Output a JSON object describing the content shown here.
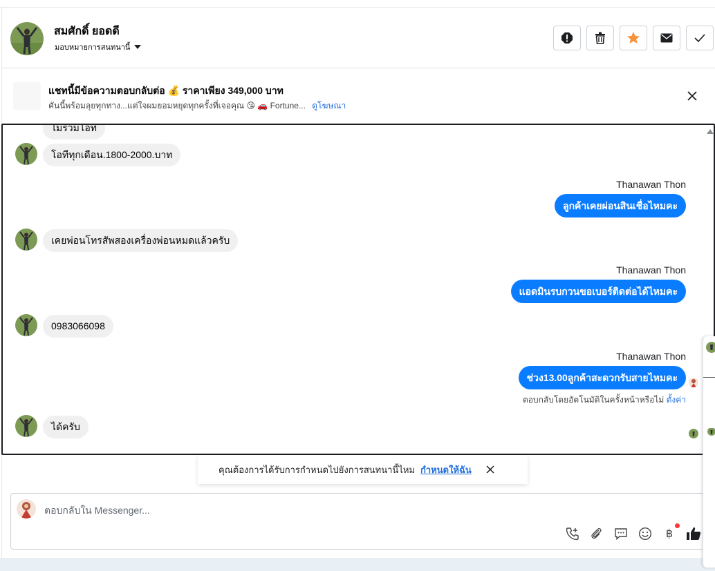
{
  "header": {
    "contact_name": "สมศักดิ์ ยอดดี",
    "assign_label": "มอบหมายการสนทนานี้",
    "actions": [
      {
        "name": "spam",
        "icon": "alert-icon"
      },
      {
        "name": "delete",
        "icon": "trash-icon"
      },
      {
        "name": "star",
        "icon": "star-icon",
        "color": "#f7923b"
      },
      {
        "name": "mark-unread",
        "icon": "envelope-icon"
      },
      {
        "name": "done",
        "icon": "check-icon"
      }
    ]
  },
  "ad": {
    "title": "แชทนี้มีข้อความตอบกลับต่อ 💰 ราคาเพียง 349,000 บาท",
    "subtitle": "คันนี้พร้อมลุยทุกทาง...แต่ใจผมยอมหยุดทุกครั้งที่เจอคุณ 😘 🚗 Fortune...",
    "link": "ดูโฆษณา"
  },
  "messages": {
    "partial_top": "ไม่รวมโอที",
    "m1": "โอทีทุกเดือน.1800-2000.บาท",
    "m2_sender": "Thanawan Thon",
    "m2": "ลูกค้าเคยผ่อนสินเชื่อไหมคะ",
    "m3": "เคยพ่อนโทรสัพสองเครื่องพ่อนหมดแล้วครับ",
    "m4_sender": "Thanawan Thon",
    "m4": "แอดมินรบกวนขอเบอร์ติดต่อได้ไหมคะ",
    "m5": "0983066098",
    "m6_sender": "Thanawan Thon",
    "m6": "ช่วง13.00ลูกค้าสะดวกรับสายไหมคะ",
    "auto_note": "ตอบกลับโดยอัตโนมัติในครั้งหน้าหรือไม่",
    "auto_note_link": "ตั้งค่า",
    "m7": "ได้ครับ"
  },
  "assign_prompt": {
    "text": "คุณต้องการได้รับการกำหนดไปยังการสนทนานี้ไหม",
    "link": "กำหนดให้ฉัน"
  },
  "composer": {
    "placeholder": "ตอบกลับใน Messenger...",
    "icons": [
      "phone-plus-icon",
      "attachment-icon",
      "saved-reply-icon",
      "emoji-icon",
      "baht-icon",
      "thumbs-up-icon"
    ],
    "baht_glyph": "฿"
  },
  "colors": {
    "outgoing_bubble": "#0a7cff",
    "incoming_bubble": "#f0f0f0",
    "link": "#216fdb",
    "like": "#1c1e21"
  }
}
